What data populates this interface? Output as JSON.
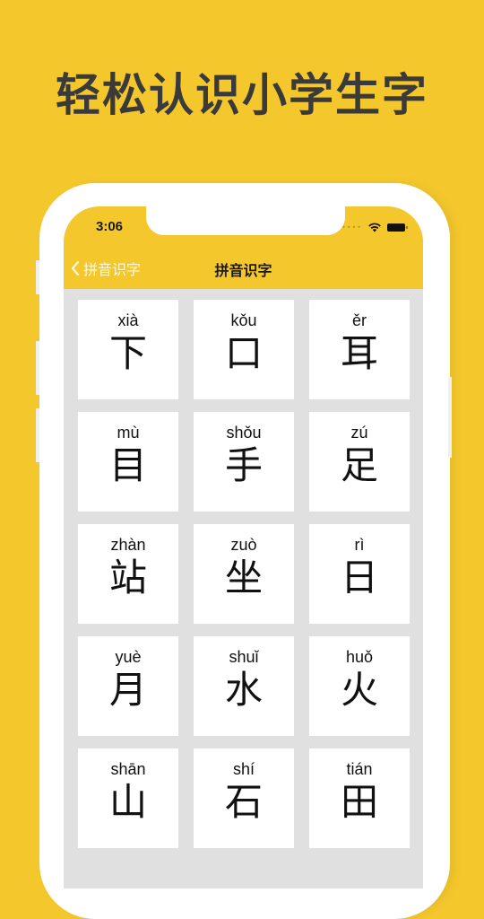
{
  "headline": "轻松认识小学生字",
  "status_bar": {
    "time": "3:06",
    "icons": [
      "signal-dots-icon",
      "wifi-icon",
      "battery-icon"
    ]
  },
  "nav": {
    "back_label": "拼音识字",
    "back_icon": "chevron-left-icon",
    "title": "拼音识字"
  },
  "colors": {
    "brand_yellow": "#f4c82c",
    "grid_background": "#e0e0e0",
    "card_background": "#ffffff",
    "headline_text": "#3a3a3a"
  },
  "cards": [
    {
      "pinyin": "xià",
      "hanzi": "下"
    },
    {
      "pinyin": "kǒu",
      "hanzi": "口"
    },
    {
      "pinyin": "ěr",
      "hanzi": "耳"
    },
    {
      "pinyin": "mù",
      "hanzi": "目"
    },
    {
      "pinyin": "shǒu",
      "hanzi": "手"
    },
    {
      "pinyin": "zú",
      "hanzi": "足"
    },
    {
      "pinyin": "zhàn",
      "hanzi": "站"
    },
    {
      "pinyin": "zuò",
      "hanzi": "坐"
    },
    {
      "pinyin": "rì",
      "hanzi": "日"
    },
    {
      "pinyin": "yuè",
      "hanzi": "月"
    },
    {
      "pinyin": "shuǐ",
      "hanzi": "水"
    },
    {
      "pinyin": "huǒ",
      "hanzi": "火"
    },
    {
      "pinyin": "shān",
      "hanzi": "山"
    },
    {
      "pinyin": "shí",
      "hanzi": "石"
    },
    {
      "pinyin": "tián",
      "hanzi": "田"
    }
  ]
}
